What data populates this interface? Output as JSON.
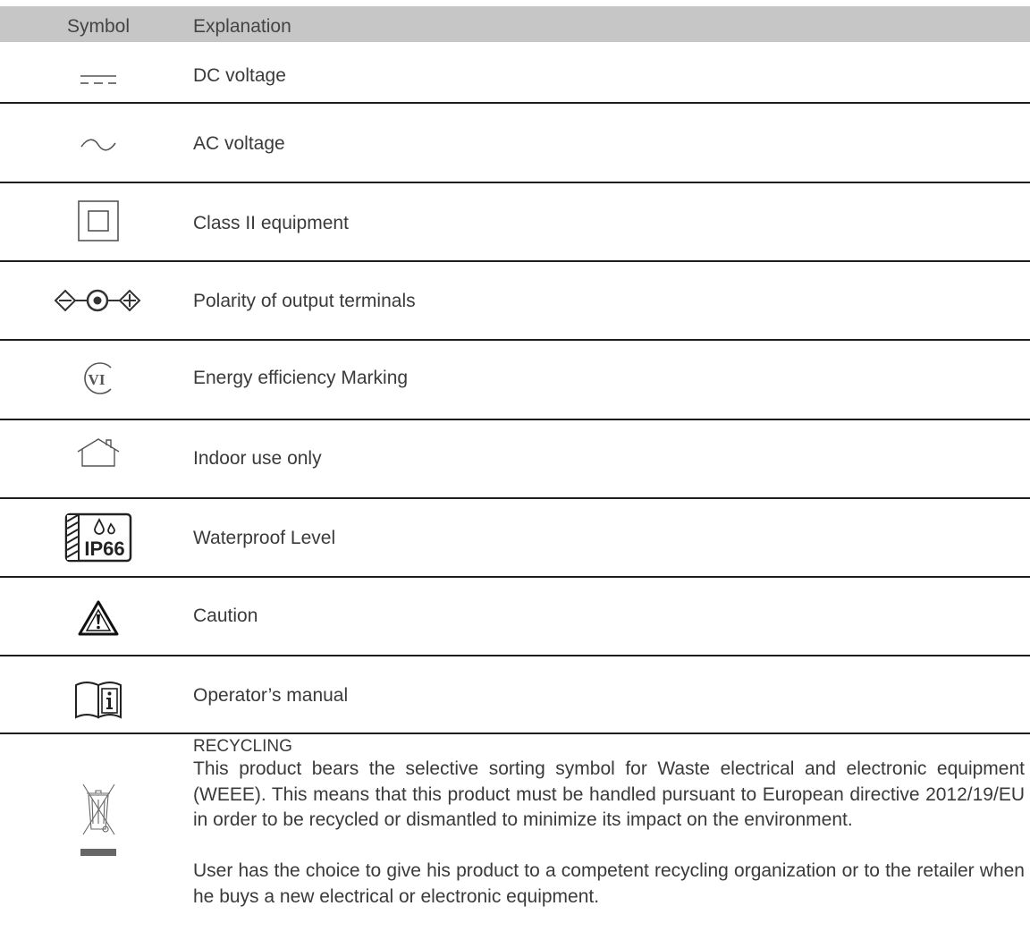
{
  "header": {
    "symbol_label": "Symbol",
    "explanation_label": "Explanation"
  },
  "rows": [
    {
      "icon": "dc-voltage-icon",
      "text": "DC voltage"
    },
    {
      "icon": "ac-voltage-icon",
      "text": "AC voltage"
    },
    {
      "icon": "class-ii-equipment-icon",
      "text": "Class II equipment"
    },
    {
      "icon": "polarity-icon",
      "text": "Polarity of output terminals"
    },
    {
      "icon": "energy-efficiency-icon",
      "text": "Energy efficiency Marking"
    },
    {
      "icon": "indoor-use-icon",
      "text": "Indoor use only"
    },
    {
      "icon": "waterproof-ip66-icon",
      "text": "Waterproof Level"
    },
    {
      "icon": "caution-icon",
      "text": "Caution"
    },
    {
      "icon": "operator-manual-icon",
      "text": "Operator’s manual"
    }
  ],
  "icon_text": {
    "energy": "VI",
    "waterproof": "IP66"
  },
  "recycling": {
    "icon": "weee-crossed-bin-icon",
    "title": "RECYCLING",
    "paragraph1": "This product bears the selective sorting symbol for Waste electrical and electronic equipment (WEEE). This means that this product must be handled pursuant to European directive 2012/19/EU in order to be recycled or dismantled to minimize its impact on the environment.",
    "paragraph2": "User has the choice to give his product to a competent recycling organization or to the retailer when he buys a new electrical or electronic equipment."
  }
}
